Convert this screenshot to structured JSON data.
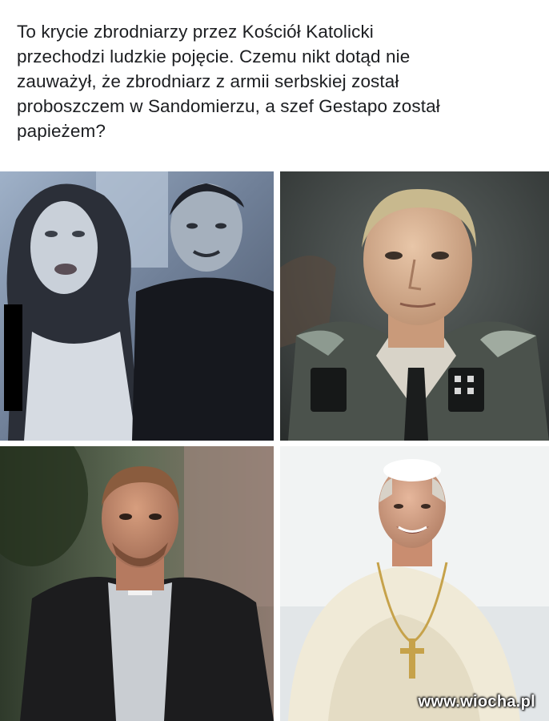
{
  "post": {
    "caption": "To krycie zbrodniarzy przez Kościół Katolicki\nprzechodzi ludzkie pojęcie. Czemu nikt dotąd nie\nzauważył, że zbrodniarz z armii serbskiej został\nproboszczem w Sandomierzu, a szef Gestapo został\npapieżem?"
  },
  "watermark": {
    "text": "www.wiocha.pl"
  },
  "colors": {
    "text": "#1c1e21",
    "background": "#ffffff",
    "watermark": "#ffffff"
  }
}
